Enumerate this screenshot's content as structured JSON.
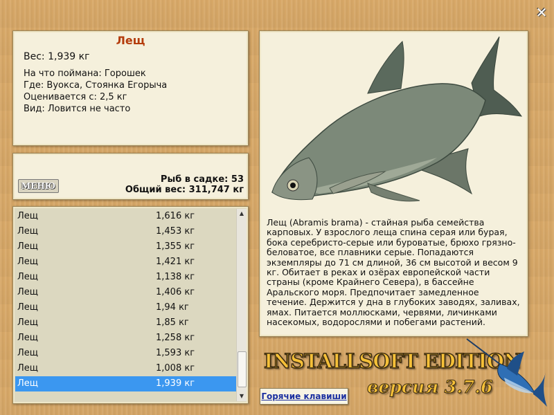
{
  "close_symbol": "✕",
  "info": {
    "title": "Лещ",
    "weight": "Вес: 1,939 кг",
    "caught_with": "На что поймана: Горошек",
    "where": "Где: Вуокса, Стоянка Егорыча",
    "valued_from": "Оценивается с: 2,5 кг",
    "kind": "Вид: Ловится не часто"
  },
  "summary": {
    "menu_label": "МЕНЮ",
    "fish_count": "Рыб в садке: 53",
    "total_weight": "Общий вес: 311,747 кг"
  },
  "catch_list": [
    {
      "name": "Лещ",
      "weight": "1,616 кг"
    },
    {
      "name": "Лещ",
      "weight": "1,453 кг"
    },
    {
      "name": "Лещ",
      "weight": "1,355 кг"
    },
    {
      "name": "Лещ",
      "weight": "1,421 кг"
    },
    {
      "name": "Лещ",
      "weight": "1,138 кг"
    },
    {
      "name": "Лещ",
      "weight": "1,406 кг"
    },
    {
      "name": "Лещ",
      "weight": "1,94 кг"
    },
    {
      "name": "Лещ",
      "weight": "1,85 кг"
    },
    {
      "name": "Лещ",
      "weight": "1,258 кг"
    },
    {
      "name": "Лещ",
      "weight": "1,593 кг"
    },
    {
      "name": "Лещ",
      "weight": "1,008 кг"
    },
    {
      "name": "Лещ",
      "weight": "1,939 кг",
      "selected": true
    }
  ],
  "description": "Лещ (Abramis brama) - стайная рыба семейства карповых. У взрослого леща спина серая или бурая, бока серебристо-серые или буроватые, брюхо грязно-беловатое, все плавники серые. Попадаются экземпляры до 71 см длиной, 36 см высотой и весом 9 кг. Обитает в реках и озёрах европейской части страны (кроме Крайнего Севера), в бассейне Аральского моря. Предпочитает замедленное течение. Держится у дна в глубоких заводях, заливах, ямах. Питается моллюсками, червями, личинками насекомых, водорослями и побегами растений.",
  "hotkeys_label": "Горячие клавиши",
  "logo": {
    "line1": "INSTALLSOFT EDITION",
    "line2": "версия 3.7.6"
  },
  "icons": {
    "close": "close-icon",
    "fish_image": "bream-fish-image",
    "logo_fish": "marlin-logo-icon",
    "scroll_up": "scroll-up-arrow-icon",
    "scroll_down": "scroll-down-arrow-icon"
  },
  "colors": {
    "title": "#b43c0c",
    "selection": "#3b97f0",
    "link": "#1b2fa0"
  }
}
